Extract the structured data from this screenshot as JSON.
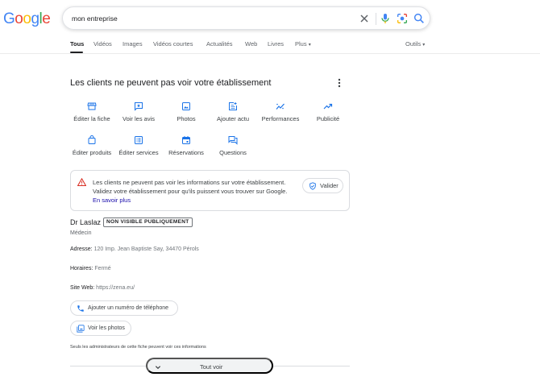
{
  "logo": {
    "letters": [
      "G",
      "o",
      "o",
      "g",
      "l",
      "e"
    ],
    "colors": [
      "#4285F4",
      "#EA4335",
      "#FBBC05",
      "#4285F4",
      "#34A853",
      "#EA4335"
    ]
  },
  "search": {
    "query": "mon entreprise"
  },
  "tabs": [
    {
      "label": "Tous",
      "active": true
    },
    {
      "label": "Vidéos"
    },
    {
      "label": "Images"
    },
    {
      "label": "Vidéos courtes"
    },
    {
      "label": "Actualités"
    },
    {
      "label": "Web"
    },
    {
      "label": "Livres"
    },
    {
      "label": "Plus"
    }
  ],
  "tools_label": "Outils",
  "business": {
    "title": "Les clients ne peuvent pas voir votre établissement",
    "actions": [
      {
        "label": "Éditer la fiche",
        "icon": "storefront-icon"
      },
      {
        "label": "Voir les avis",
        "icon": "reviews-icon"
      },
      {
        "label": "Photos",
        "icon": "photo-icon"
      },
      {
        "label": "Ajouter actu",
        "icon": "post-add-icon"
      },
      {
        "label": "Performances",
        "icon": "performance-icon"
      },
      {
        "label": "Publicité",
        "icon": "trending-up-icon"
      },
      {
        "label": "Éditer produits",
        "icon": "shopping-bag-icon"
      },
      {
        "label": "Éditer services",
        "icon": "list-icon"
      },
      {
        "label": "Réservations",
        "icon": "calendar-icon"
      },
      {
        "label": "Questions",
        "icon": "forum-icon"
      }
    ],
    "alert": {
      "text": "Les clients ne peuvent pas voir les informations sur votre établissement. Validez votre établissement pour qu'ils puissent vous trouver sur Google.",
      "link": "En savoir plus",
      "button": "Valider"
    },
    "name": "Dr Laslaz",
    "badge": "NON VISIBLE PUBLIQUEMENT",
    "category": "Médecin",
    "address_label": "Adresse:",
    "address": "120 Imp. Jean Baptiste Say, 34470 Pérols",
    "hours_label": "Horaires:",
    "hours": "Fermé",
    "website_label": "Site Web:",
    "website": "https://zena.eu/",
    "add_phone": "Ajouter un numéro de téléphone",
    "see_photos": "Voir les photos",
    "admin_note": "Seuls les administrateurs de cette fiche peuvent voir ces informations",
    "see_all": "Tout voir"
  },
  "colors": {
    "accent": "#1a73e8",
    "warning": "#d93025",
    "link": "#1a0dab"
  }
}
